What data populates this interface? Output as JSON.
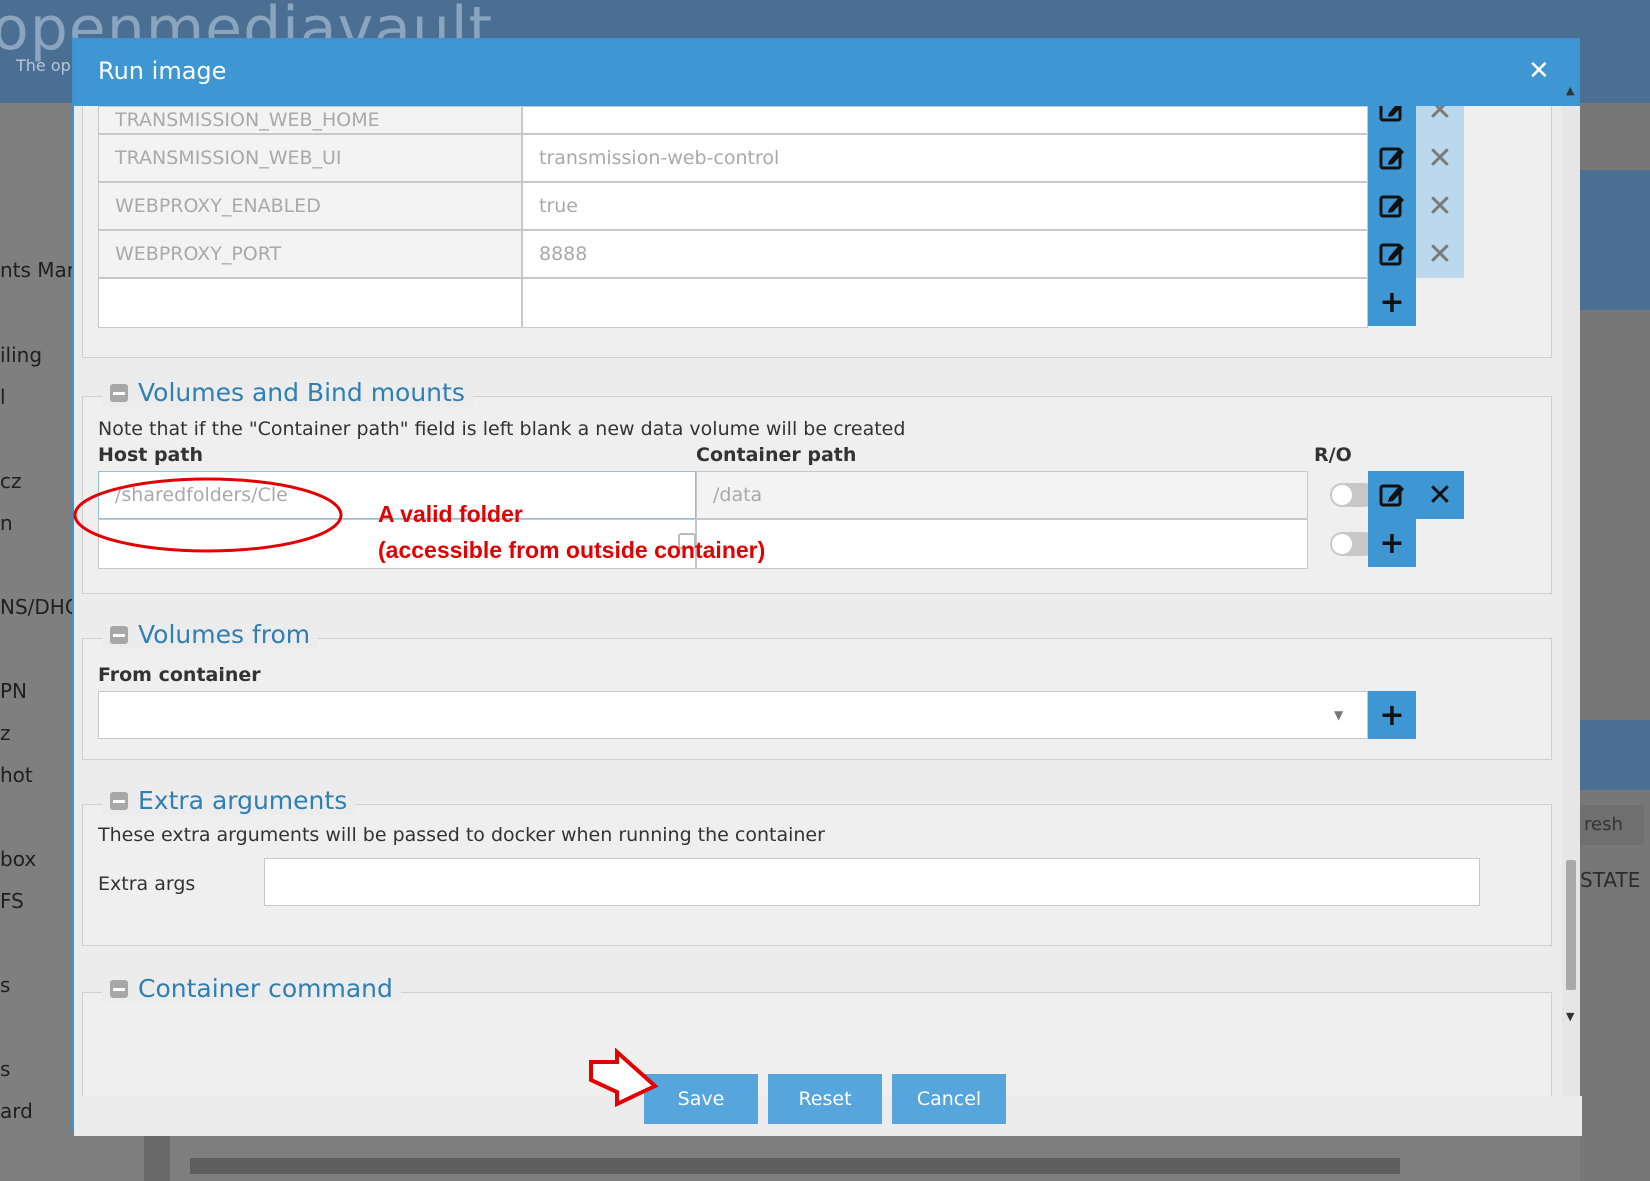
{
  "background": {
    "logo_text": "openmediavault",
    "tagline": "The op",
    "sidebar_items": [
      "nts Man",
      "iling",
      "l",
      "cz",
      "n",
      "NS/DHC",
      "PN",
      "z",
      "hot",
      "box",
      "FS",
      "s",
      "s",
      "ard"
    ],
    "refresh_label": "resh",
    "state_label": "STATE"
  },
  "dialog": {
    "title": "Run image",
    "env_rows": [
      {
        "name": "TRANSMISSION_WEB_HOME",
        "value": ""
      },
      {
        "name": "TRANSMISSION_WEB_UI",
        "value": "transmission-web-control"
      },
      {
        "name": "WEBPROXY_ENABLED",
        "value": "true"
      },
      {
        "name": "WEBPROXY_PORT",
        "value": "8888"
      },
      {
        "name": "",
        "value": ""
      }
    ],
    "volumes": {
      "legend": "Volumes and Bind mounts",
      "note": "Note that if the \"Container path\" field is left blank a new data volume will be created",
      "host_path_label": "Host path",
      "container_path_label": "Container path",
      "ro_label": "R/O",
      "rows": [
        {
          "host_path": "/sharedfolders/Cle",
          "container_path": "/data"
        },
        {
          "host_path": "",
          "container_path": ""
        }
      ]
    },
    "volumes_from": {
      "legend": "Volumes from",
      "from_container_label": "From container",
      "selected": ""
    },
    "extra_args": {
      "legend": "Extra arguments",
      "note": "These extra arguments will be passed to docker when running the container",
      "label": "Extra args",
      "value": ""
    },
    "container_command": {
      "legend": "Container command"
    },
    "footer": {
      "save": "Save",
      "reset": "Reset",
      "cancel": "Cancel"
    }
  },
  "annotation": {
    "line1": "A valid folder",
    "line2": "(accessible from outside container)",
    "color": "#e30000"
  }
}
